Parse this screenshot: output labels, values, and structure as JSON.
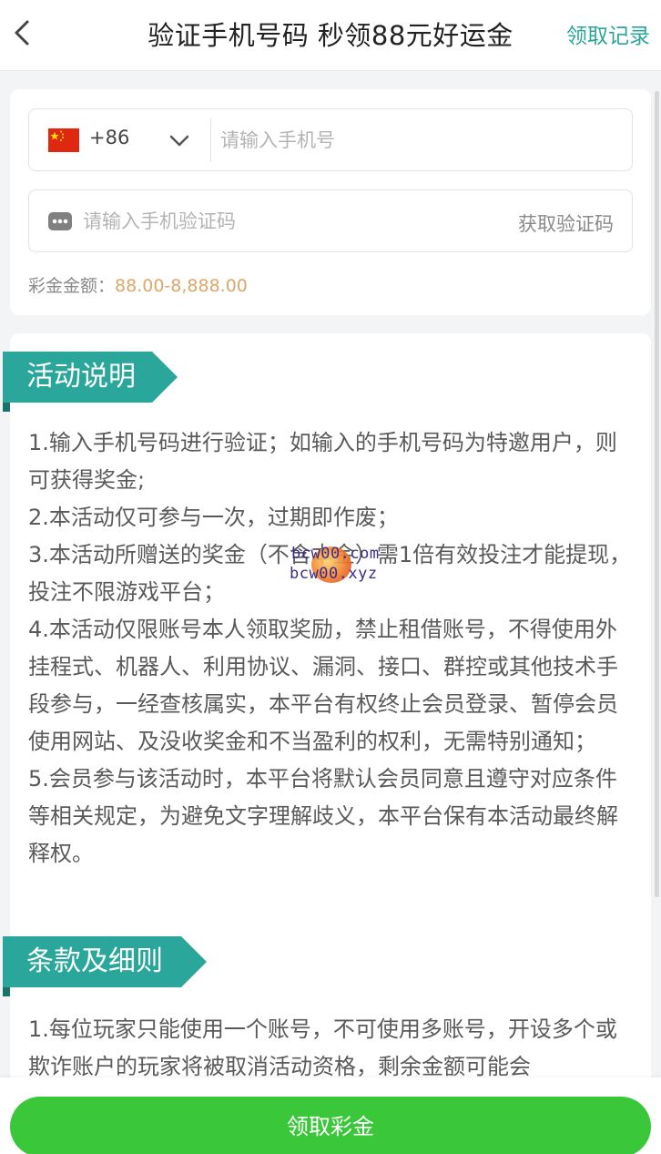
{
  "header": {
    "title": "验证手机号码 秒领88元好运金",
    "record_link": "领取记录"
  },
  "form": {
    "country_code": "+86",
    "phone_placeholder": "请输入手机号",
    "code_placeholder": "请输入手机验证码",
    "get_code_label": "获取验证码",
    "amount_label": "彩金金额：",
    "amount_value": "88.00-8,888.00"
  },
  "activity": {
    "title": "活动说明",
    "rules": [
      "1.输入手机号码进行验证；如输入的手机号码为特邀用户，则可获得奖金;",
      "2.本活动仅可参与一次，过期即作废；",
      "3.本活动所赠送的奖金（不含本金）需1倍有效投注才能提现，投注不限游戏平台；",
      "4.本活动仅限账号本人领取奖励，禁止租借账号，不得使用外挂程式、机器人、利用协议、漏洞、接口、群控或其他技术手段参与，一经查核属实，本平台有权终止会员登录、暂停会员使用网站、及没收奖金和不当盈利的权利，无需特别通知；",
      "5.会员参与该活动时，本平台将默认会员同意且遵守对应条件等相关规定，为避免文字理解歧义，本平台保有本活动最终解释权。"
    ]
  },
  "terms": {
    "title": "条款及细则",
    "rules": [
      "1.每位玩家只能使用一个账号，不可使用多账号，开设多个或欺诈账户的玩家将被取消活动资格，剩余金额可能会"
    ]
  },
  "watermark": {
    "line1": "bcw00.com",
    "line2": "bcw00.xyz"
  },
  "bottom": {
    "claim_label": "领取彩金"
  },
  "colors": {
    "accent": "#2aa69a",
    "button": "#3ac83a",
    "amount": "#d9a86a"
  }
}
